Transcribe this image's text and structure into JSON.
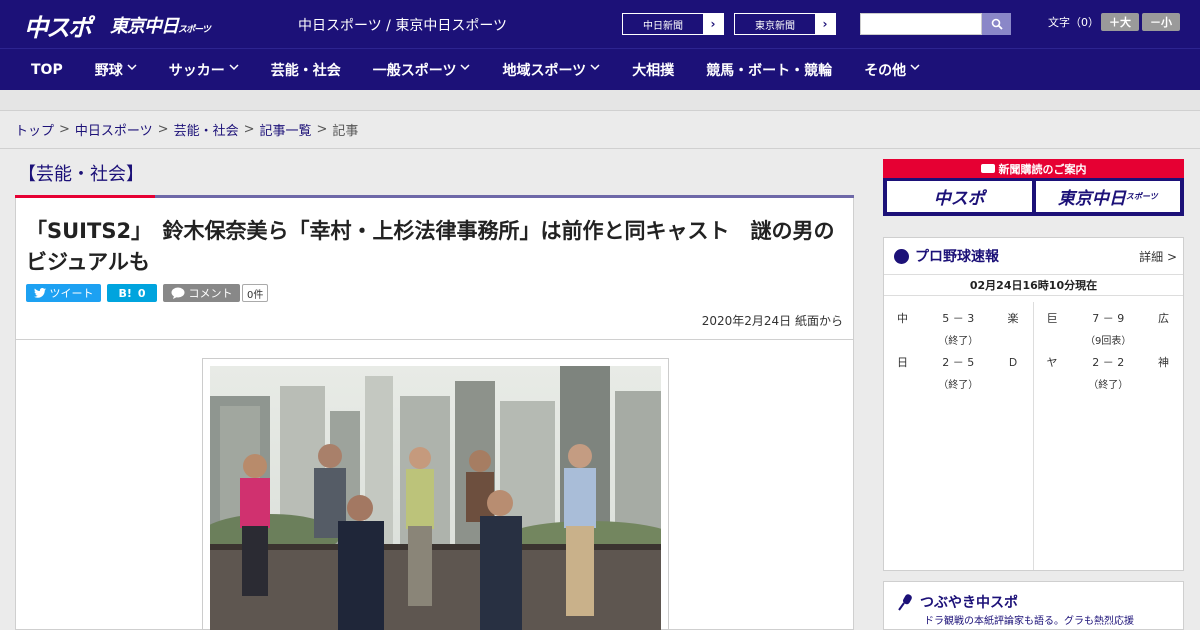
{
  "header": {
    "logo_chuspo": "中スポ",
    "logo_tokyo": "東京中日",
    "logo_tokyo_small": "スポーツ",
    "site_names": "中日スポーツ / 東京中日スポーツ",
    "ext_links": [
      {
        "label": "中日新聞"
      },
      {
        "label": "東京新聞"
      }
    ],
    "search_placeholder": "",
    "font_label": "文字（0）",
    "font_plus": "＋大",
    "font_minus": "－小"
  },
  "nav": {
    "items": [
      {
        "label": "TOP",
        "has_dropdown": false
      },
      {
        "label": "野球",
        "has_dropdown": true
      },
      {
        "label": "サッカー",
        "has_dropdown": true
      },
      {
        "label": "芸能・社会",
        "has_dropdown": false
      },
      {
        "label": "一般スポーツ",
        "has_dropdown": true
      },
      {
        "label": "地域スポーツ",
        "has_dropdown": true
      },
      {
        "label": "大相撲",
        "has_dropdown": false
      },
      {
        "label": "競馬・ボート・競輪",
        "has_dropdown": false
      },
      {
        "label": "その他",
        "has_dropdown": true
      }
    ]
  },
  "breadcrumb": {
    "items": [
      "トップ",
      "中日スポーツ",
      "芸能・社会",
      "記事一覧"
    ],
    "current": "記事",
    "separator": ">"
  },
  "article": {
    "category": "【芸能・社会】",
    "headline": "「SUITS2」　鈴木保奈美ら「幸村・上杉法律事務所」は前作と同キャスト　謎の男のビジュアルも",
    "share": {
      "tweet": "ツイート",
      "hatena_count": "0",
      "comment": "コメント",
      "comment_count": "0件"
    },
    "dateline": "2020年2月24日 紙面から"
  },
  "sidebar": {
    "ad_top": "新聞購読のご案内",
    "ad_logo_1": "中スポ",
    "ad_logo_2": "東京中日",
    "ad_logo_2_small": "スポーツ",
    "scores_title": "プロ野球速報",
    "scores_more": "詳細 >",
    "scores_time": "02月24日16時10分現在",
    "games_left": [
      {
        "team1": "中",
        "score": "5 － 3",
        "team2": "楽",
        "status": "（終了）"
      },
      {
        "team1": "日",
        "score": "2 － 5",
        "team2": "Ｄ",
        "status": "（終了）"
      }
    ],
    "games_right": [
      {
        "team1": "巨",
        "score": "7 － 9",
        "team2": "広",
        "status": "（9回表）"
      },
      {
        "team1": "ヤ",
        "score": "2 － 2",
        "team2": "神",
        "status": "（終了）"
      }
    ],
    "tweet_title": "つぶやき中スポ",
    "tweet_sub": "ドラ観戦の本紙評論家も語る。グラも熱烈応援"
  },
  "colors": {
    "brand_navy": "#1c1178",
    "accent_red": "#e60033",
    "twitter_blue": "#1da1f2",
    "hatena_blue": "#00a4de"
  }
}
